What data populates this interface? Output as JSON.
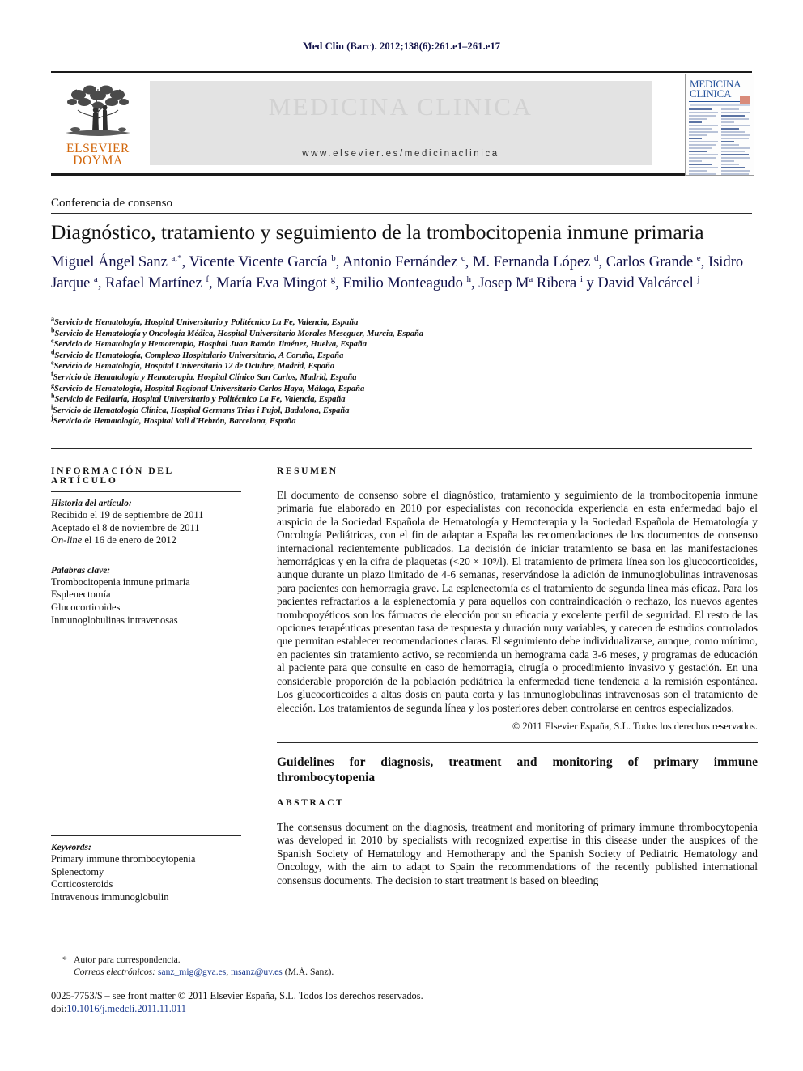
{
  "running_head": "Med Clin (Barc). 2012;138(6):261.e1–261.e17",
  "masthead": {
    "journal_name": "MEDICINA CLINICA",
    "url": "www.elsevier.es/medicinaclinica",
    "publisher_line1": "ELSEVIER",
    "publisher_line2": "DOYMA",
    "logo_icon": "elsevier-tree-logo",
    "cover_title_line1": "MEDICINA",
    "cover_title_line2": "CLINICA"
  },
  "article": {
    "kicker": "Conferencia de consenso",
    "title": "Diagnóstico, tratamiento y seguimiento de la trombocitopenia inmune primaria",
    "authors_html": "Miguel Ángel Sanz <sup>a,*</sup>, Vicente Vicente García <sup>b</sup>, Antonio Fernández <sup>c</sup>, M. Fernanda López <sup>d</sup>, Carlos Grande <sup>e</sup>, Isidro Jarque <sup>a</sup>, Rafael Martínez <sup>f</sup>, María Eva Mingot <sup>g</sup>, Emilio Monteagudo <sup>h</sup>, Josep M<sup>a</sup> Ribera <sup>i</sup> y David Valcárcel <sup>j</sup>",
    "affiliations": [
      {
        "marker": "a",
        "text": "Servicio de Hematología, Hospital Universitario y Politécnico La Fe, Valencia, España"
      },
      {
        "marker": "b",
        "text": "Servicio de Hematología y Oncología Médica, Hospital Universitario Morales Meseguer, Murcia, España"
      },
      {
        "marker": "c",
        "text": "Servicio de Hematología y Hemoterapia, Hospital Juan Ramón Jiménez, Huelva, España"
      },
      {
        "marker": "d",
        "text": "Servicio de Hematología, Complexo Hospitalario Universitario, A Coruña, España"
      },
      {
        "marker": "e",
        "text": "Servicio de Hematología, Hospital Universitario 12 de Octubre, Madrid, España"
      },
      {
        "marker": "f",
        "text": "Servicio de Hematología y Hemoterapia, Hospital Clínico San Carlos, Madrid, España"
      },
      {
        "marker": "g",
        "text": "Servicio de Hematología, Hospital Regional Universitario Carlos Haya, Málaga, España"
      },
      {
        "marker": "h",
        "text": "Servicio de Pediatría, Hospital Universitario y Politécnico La Fe, Valencia, España"
      },
      {
        "marker": "i",
        "text": "Servicio de Hematología Clínica, Hospital Germans Trias i Pujol, Badalona, España"
      },
      {
        "marker": "j",
        "text": "Servicio de Hematología, Hospital Vall d'Hebrón, Barcelona, España"
      }
    ]
  },
  "info_panel": {
    "heading": "INFORMACIÓN DEL ARTÍCULO",
    "history_label": "Historia del artículo:",
    "history": [
      "Recibido el 19 de septiembre de 2011",
      "Aceptado el 8 de noviembre de 2011"
    ],
    "online_prefix": "On-line",
    "online_rest": " el 16 de enero de 2012",
    "keywords_label": "Palabras clave:",
    "keywords": [
      "Trombocitopenia inmune primaria",
      "Esplenectomía",
      "Glucocorticoides",
      "Inmunoglobulinas intravenosas"
    ],
    "keywords_en_label": "Keywords:",
    "keywords_en": [
      "Primary immune thrombocytopenia",
      "Splenectomy",
      "Corticosteroids",
      "Intravenous immunoglobulin"
    ]
  },
  "abstract_es": {
    "heading": "RESUMEN",
    "body": "El documento de consenso sobre el diagnóstico, tratamiento y seguimiento de la trombocitopenia inmune primaria fue elaborado en 2010 por especialistas con reconocida experiencia en esta enfermedad bajo el auspicio de la Sociedad Española de Hematología y Hemoterapia y la Sociedad Española de Hematología y Oncología Pediátricas, con el fin de adaptar a España las recomendaciones de los documentos de consenso internacional recientemente publicados. La decisión de iniciar tratamiento se basa en las manifestaciones hemorrágicas y en la cifra de plaquetas (<20 × 10⁹/l). El tratamiento de primera línea son los glucocorticoides, aunque durante un plazo limitado de 4-6 semanas, reservándose la adición de inmunoglobulinas intravenosas para pacientes con hemorragia grave. La esplenectomía es el tratamiento de segunda línea más eficaz. Para los pacientes refractarios a la esplenectomía y para aquellos con contraindicación o rechazo, los nuevos agentes trombopoyéticos son los fármacos de elección por su eficacia y excelente perfil de seguridad. El resto de las opciones terapéuticas presentan tasa de respuesta y duración muy variables, y carecen de estudios controlados que permitan establecer recomendaciones claras. El seguimiento debe individualizarse, aunque, como mínimo, en pacientes sin tratamiento activo, se recomienda un hemograma cada 3-6 meses, y programas de educación al paciente para que consulte en caso de hemorragia, cirugía o procedimiento invasivo y gestación. En una considerable proporción de la población pediátrica la enfermedad tiene tendencia a la remisión espontánea. Los glucocorticoides a altas dosis en pauta corta y las inmunoglobulinas intravenosas son el tratamiento de elección. Los tratamientos de segunda línea y los posteriores deben controlarse en centros especializados.",
    "copyright": "© 2011 Elsevier España, S.L. Todos los derechos reservados."
  },
  "abstract_en": {
    "title": "Guidelines for diagnosis, treatment and monitoring of primary immune thrombocytopenia",
    "heading": "ABSTRACT",
    "body": "The consensus document on the diagnosis, treatment and monitoring of primary immune thrombocytopenia was developed in 2010 by specialists with recognized expertise in this disease under the auspices of the Spanish Society of Hematology and Hemotherapy and the Spanish Society of Pediatric Hematology and Oncology, with the aim to adapt to Spain the recommendations of the recently published international consensus documents. The decision to start treatment is based on bleeding"
  },
  "footer": {
    "corresponding_marker": "*",
    "corresponding_label": "Autor para correspondencia.",
    "email_label": "Correos electrónicos:",
    "email1": "sanz_mig@gva.es",
    "email2": "msanz@uv.es",
    "email_owner": "(M.Á. Sanz).",
    "imprint": "0025-7753/$ – see front matter © 2011 Elsevier España, S.L. Todos los derechos reservados.",
    "doi_label": "doi:",
    "doi_value": "10.1016/j.medcli.2011.11.011"
  },
  "colors": {
    "author_navy": "#12124a",
    "link_blue": "#1b3a8f",
    "elsevier_orange": "#d2660a",
    "masthead_band": "#e3e3e3"
  }
}
